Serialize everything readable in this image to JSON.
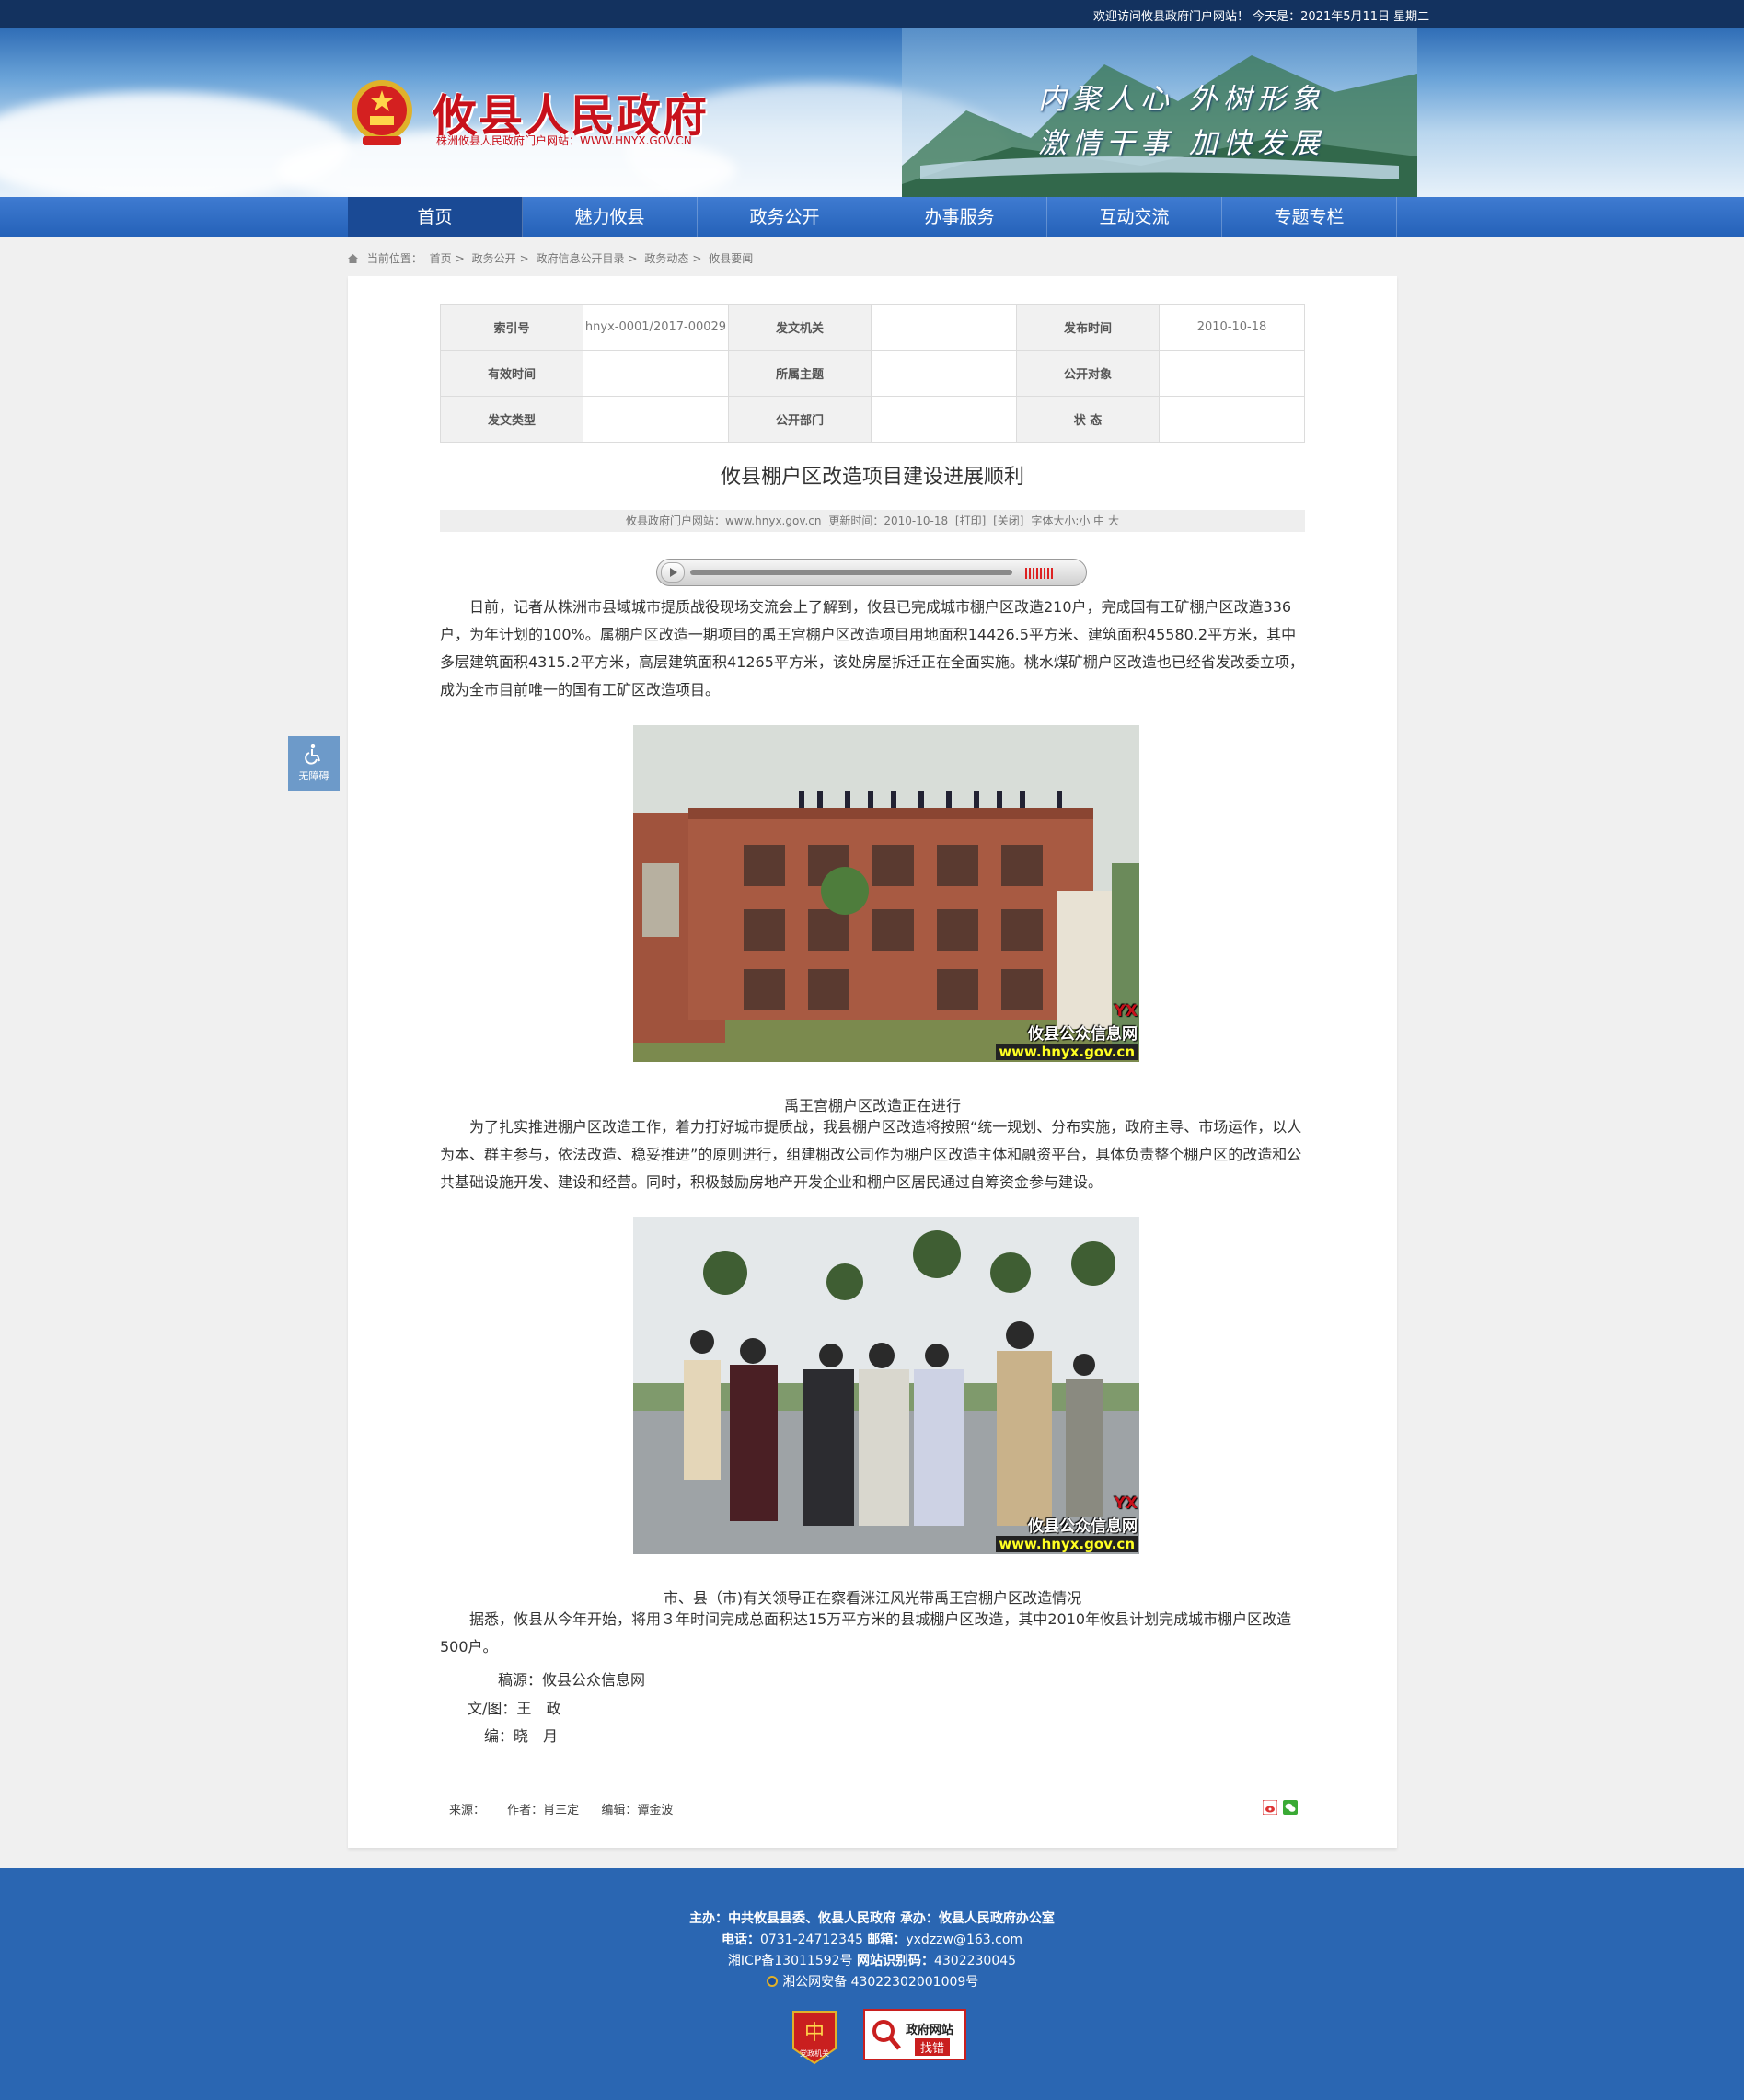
{
  "topbar": {
    "greeting": "欢迎访问攸县政府门户网站！ 今天是：2021年5月11日 星期二"
  },
  "header": {
    "title": "攸县人民政府",
    "subtitle": "株洲攸县人民政府门户网站：WWW.HNYX.GOV.CN",
    "slogan_line1": "内聚人心  外树形象",
    "slogan_line2": "激情干事  加快发展"
  },
  "nav": {
    "items": [
      "首页",
      "魅力攸县",
      "政务公开",
      "办事服务",
      "互动交流",
      "专题专栏"
    ],
    "active": "首页"
  },
  "breadcrumb": {
    "label": "当前位置：",
    "items": [
      "首页",
      "政务公开",
      "政府信息公开目录",
      "政务动态",
      "攸县要闻"
    ],
    "separator": ">"
  },
  "meta_table": {
    "rows": [
      [
        {
          "k": "索引号",
          "v": "hnyx-0001/2017-00029"
        },
        {
          "k": "发文机关",
          "v": ""
        },
        {
          "k": "发布时间",
          "v": "2010-10-18"
        }
      ],
      [
        {
          "k": "有效时间",
          "v": ""
        },
        {
          "k": "所属主题",
          "v": ""
        },
        {
          "k": "公开对象",
          "v": ""
        }
      ],
      [
        {
          "k": "发文类型",
          "v": ""
        },
        {
          "k": "公开部门",
          "v": ""
        },
        {
          "k": "状 态",
          "v": ""
        }
      ]
    ]
  },
  "article": {
    "title": "攸县棚户区改造项目建设进展顺利",
    "info": {
      "source": "攸县政府门户网站：www.hnyx.gov.cn",
      "updated": "更新时间：2010-10-18",
      "print": "[打印]",
      "close": "[关闭]",
      "font_size": "字体大小:小 中 大"
    },
    "para1": "日前，记者从株洲市县域城市提质战役现场交流会上了解到，攸县已完成城市棚户区改造210户，完成国有工矿棚户区改造336户，为年计划的100%。属棚户区改造一期项目的禹王宫棚户区改造项目用地面积14426.5平方米、建筑面积45580.2平方米，其中多层建筑面积4315.2平方米，高层建筑面积41265平方米，该处房屋拆迁正在全面实施。桃水煤矿棚户区改造也已经省发改委立项，成为全市目前唯一的国有工矿区改造项目。",
    "caption1": "禹王宫棚户区改造正在进行",
    "para2": "为了扎实推进棚户区改造工作，着力打好城市提质战，我县棚户区改造将按照“统一规划、分布实施，政府主导、市场运作，以人为本、群主参与，依法改造、稳妥推进”的原则进行，组建棚改公司作为棚户区改造主体和融资平台，具体负责整个棚户区的改造和公共基础设施开发、建设和经营。同时，积极鼓励房地产开发企业和棚户区居民通过自筹资金参与建设。",
    "caption2": "市、县（市)有关领导正在察看洣江风光带禹王宫棚户区改造情况",
    "para3": "据悉，攸县从今年开始，将用３年时间完成总面积达15万平方米的县城棚户区改造，其中2010年攸县计划完成城市棚户区改造500户。",
    "credit_source": "稿源：攸县公众信息网",
    "credit_author": "文/图：王　政",
    "credit_editor": "编：晓　月",
    "watermark_text": "攸县公众信息网",
    "watermark_url": "www.hnyx.gov.cn",
    "watermark_logo": "YX"
  },
  "article_footer": {
    "source": "来源：",
    "author": "作者：肖三定",
    "editor": "编辑：谭金波"
  },
  "a11y_button": {
    "label": "无障碍",
    "icon": "wheelchair-icon"
  },
  "footer": {
    "sponsor_label": "主办：",
    "sponsor": "中共攸县县委、攸县人民政府",
    "organizer_label": "承办：",
    "organizer": "攸县人民政府办公室",
    "phone_label": "电话：",
    "phone": "0731-24712345",
    "email_label": "邮箱：",
    "email": "yxdzzw@163.com",
    "icp": "湘ICP备13011592号",
    "site_code_label": "网站识别码：",
    "site_code": "4302230045",
    "police": "湘公网安备 43022302001009号",
    "badge1_text": "党政机关",
    "badge2_line1": "政府网站",
    "badge2_line2": "找错"
  },
  "colors": {
    "nav": "#2461b8",
    "nav_active": "#1a4a95",
    "footer": "#2a66b2",
    "title_red": "#c8111b",
    "topbar": "#13325f"
  }
}
